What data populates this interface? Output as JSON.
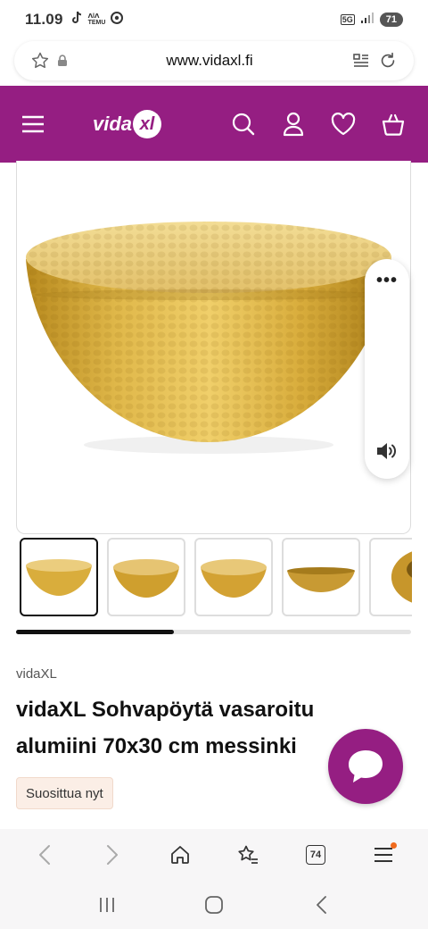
{
  "status_bar": {
    "time": "11.09",
    "app_labels": [
      "ꓥlꓥ",
      "TEMU"
    ],
    "network": "5G",
    "battery": "71"
  },
  "browser": {
    "url": "www.vidaxl.fi",
    "tabs_count": "74"
  },
  "site": {
    "logo_text": "vida",
    "logo_mark": "xl",
    "brand_color": "#951e82"
  },
  "gallery": {
    "thumbnail_count": 5,
    "selected_index": 0,
    "scroll_progress": 0.4
  },
  "product": {
    "brand": "vidaXL",
    "title": "vidaXL Sohvapöytä vasaroitu alumiini 70x30 cm messinki",
    "badge": "Suosittua nyt"
  },
  "icons": {
    "url_bar": [
      "star-icon",
      "lock-icon",
      "reader-mode-icon",
      "reload-icon"
    ],
    "header": [
      "menu-icon",
      "search-icon",
      "account-icon",
      "wishlist-heart-icon",
      "basket-icon"
    ],
    "side_panel": [
      "more-icon",
      "volume-icon"
    ],
    "toolbar": [
      "back-icon",
      "forward-icon",
      "home-icon",
      "bookmarks-icon",
      "tabs-icon",
      "menu-icon"
    ],
    "system": [
      "recents-icon",
      "home-icon",
      "back-icon"
    ]
  }
}
